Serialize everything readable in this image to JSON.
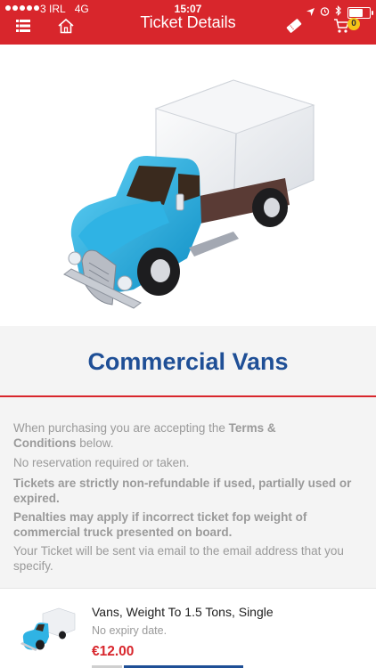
{
  "status_bar": {
    "carrier": "3 IRL",
    "network": "4G",
    "time": "15:07",
    "battery_level": 0.75
  },
  "nav": {
    "title": "Ticket Details",
    "menu_icon": "hamburger-menu-icon",
    "home_icon": "home-icon",
    "tickets_icon": "ticket-icon",
    "cart_icon": "cart-icon",
    "cart_count": "0"
  },
  "hero": {
    "image": "truck-illustration"
  },
  "product": {
    "title": "Commercial Vans"
  },
  "terms": {
    "intro_prefix": "When purchasing you are accepting the ",
    "intro_bold_1": "Terms &",
    "intro_bold_2": "Conditions",
    "intro_suffix": " below.",
    "line_no_reservation": "No reservation required or taken.",
    "line_refund_1": "Tickets are strictly non-refundable if used, partially used or",
    "line_refund_2": "expired.",
    "line_penalty_1": "Penalties may apply if incorrect ticket fop weight of",
    "line_penalty_2": "commercial truck presented on board.",
    "line_email_1": "Your Ticket will be sent via email to the email address that you",
    "line_email_2": "specify."
  },
  "ticket": {
    "name": "Vans, Weight To 1.5 Tons, Single",
    "expiry": "No expiry date.",
    "price": "€12.00"
  },
  "colors": {
    "brand_red": "#d8262c",
    "brand_blue": "#1f4f96",
    "badge_yellow": "#f5c518"
  }
}
